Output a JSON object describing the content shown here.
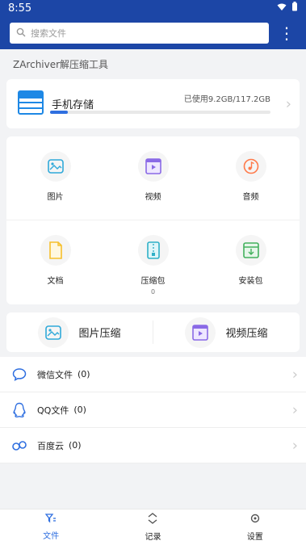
{
  "statusbar": {
    "time": "8:55"
  },
  "search": {
    "placeholder": "搜索文件"
  },
  "app": {
    "subtitle": "ZArchiver解压缩工具"
  },
  "storage": {
    "title": "手机存储",
    "used_text": "已使用9.2GB/117.2GB",
    "progress": 0.08
  },
  "grid": [
    {
      "label": "图片",
      "icon": "image-icon",
      "color": "#2fa9d9"
    },
    {
      "label": "视频",
      "icon": "video-icon",
      "color": "#8a6ae6"
    },
    {
      "label": "音频",
      "icon": "music-icon",
      "color": "#ff7a4a"
    },
    {
      "label": "文档",
      "icon": "document-icon",
      "color": "#f6c02c"
    },
    {
      "label": "压缩包",
      "icon": "archive-icon",
      "color": "#2fb0c7",
      "count": "0"
    },
    {
      "label": "安装包",
      "icon": "apk-icon",
      "color": "#43b15d"
    }
  ],
  "compress": {
    "image_label": "图片压缩",
    "video_label": "视频压缩"
  },
  "list": [
    {
      "label": "微信文件",
      "count": "(0)"
    },
    {
      "label": "QQ文件",
      "count": "(0)"
    },
    {
      "label": "百度云",
      "count": "(0)"
    }
  ],
  "tabs": {
    "files": "文件",
    "records": "记录",
    "settings": "设置"
  },
  "colors": {
    "primary": "#1c46a6",
    "accent": "#2f6fe0"
  }
}
